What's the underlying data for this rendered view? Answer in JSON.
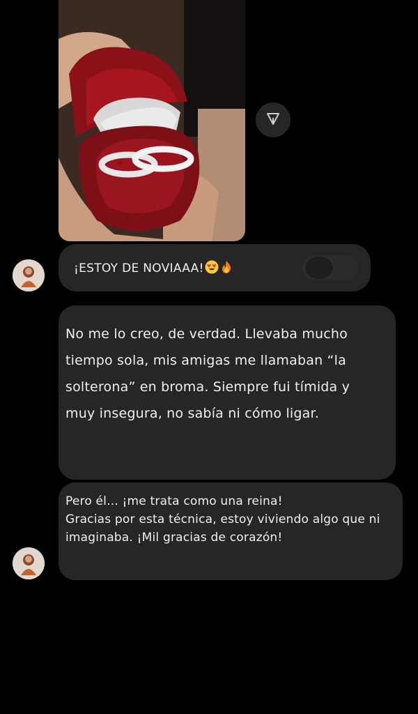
{
  "messages": [
    {
      "type": "photo",
      "icon": "ring-box-photo",
      "share_icon": "share-arrow-icon"
    },
    {
      "type": "text",
      "text": "¡ESTOY DE NOVIAAA!",
      "emojis": [
        "heart-eyes-emoji",
        "fire-emoji"
      ]
    },
    {
      "type": "text",
      "text": "No me lo creo, de verdad. Llevaba mucho tiempo sola, mis amigas me llamaban “la solterona” en broma. Siempre fui tímida y muy insegura, no sabía ni cómo ligar."
    },
    {
      "type": "text",
      "text": "Pero él... ¡me trata como una reina!\n Gracias por esta técnica, estoy viviendo algo que ni imaginaba. ¡Mil gracias de corazón!"
    }
  ],
  "colors": {
    "background": "#000000",
    "bubble": "#262626",
    "text": "#f0f0f0"
  }
}
